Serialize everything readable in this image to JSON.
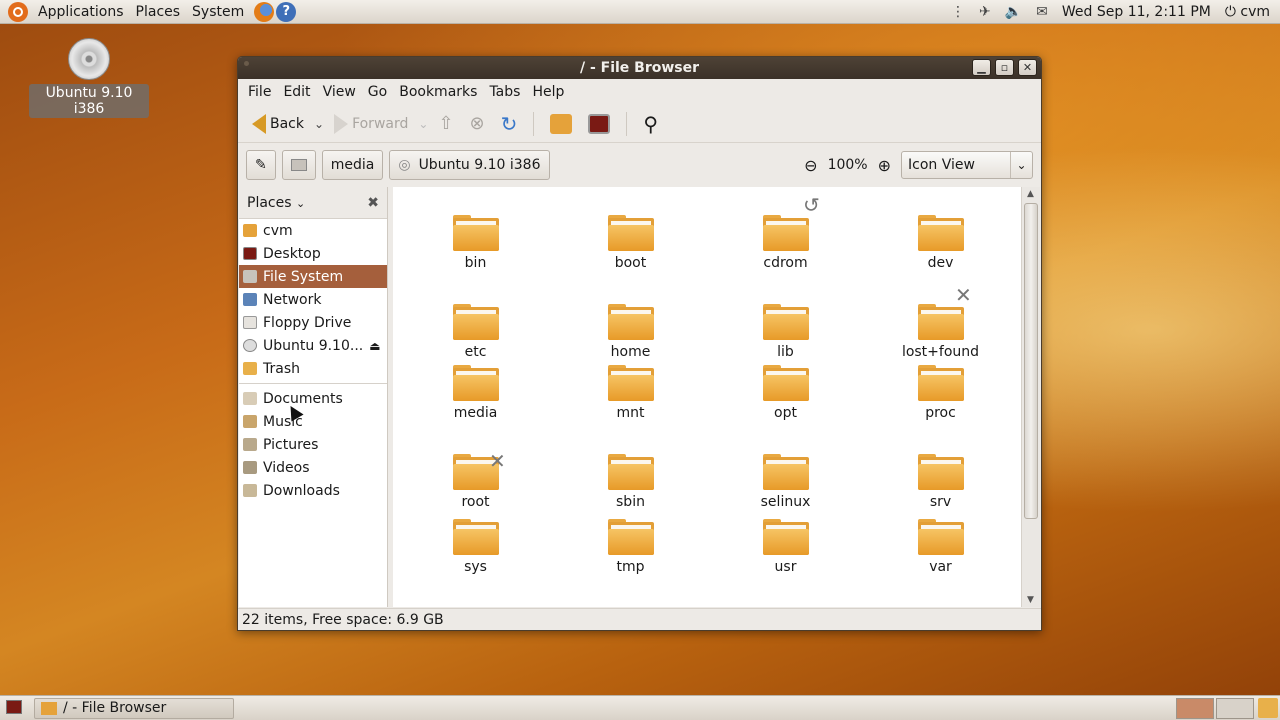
{
  "top_panel": {
    "menu": [
      "Applications",
      "Places",
      "System"
    ],
    "datetime": "Wed Sep 11,  2:11 PM",
    "user": "cvm"
  },
  "desktop": {
    "icon_label": "Ubuntu 9.10 i386"
  },
  "window": {
    "title": "/ - File Browser",
    "menubar": [
      "File",
      "Edit",
      "View",
      "Go",
      "Bookmarks",
      "Tabs",
      "Help"
    ],
    "toolbar": {
      "back": "Back",
      "forward": "Forward"
    },
    "location": {
      "crumb1": "media",
      "crumb2": "Ubuntu 9.10 i386",
      "zoom": "100%",
      "view": "Icon View"
    },
    "sidebar": {
      "header": "Places",
      "items": [
        "cvm",
        "Desktop",
        "File System",
        "Network",
        "Floppy Drive",
        "Ubuntu 9.10...",
        "Trash"
      ],
      "bookmarks": [
        "Documents",
        "Music",
        "Pictures",
        "Videos",
        "Downloads"
      ]
    },
    "files": [
      "bin",
      "boot",
      "cdrom",
      "dev",
      "etc",
      "home",
      "lib",
      "lost+found",
      "media",
      "mnt",
      "opt",
      "proc",
      "root",
      "sbin",
      "selinux",
      "srv",
      "sys",
      "tmp",
      "usr",
      "var"
    ],
    "status": "22 items, Free space: 6.9 GB"
  },
  "taskbar": {
    "task": "/ - File Browser"
  },
  "colors": {
    "selection": "#a55f3c",
    "folder": "#e79a28",
    "titlebar": "#3b3128"
  }
}
